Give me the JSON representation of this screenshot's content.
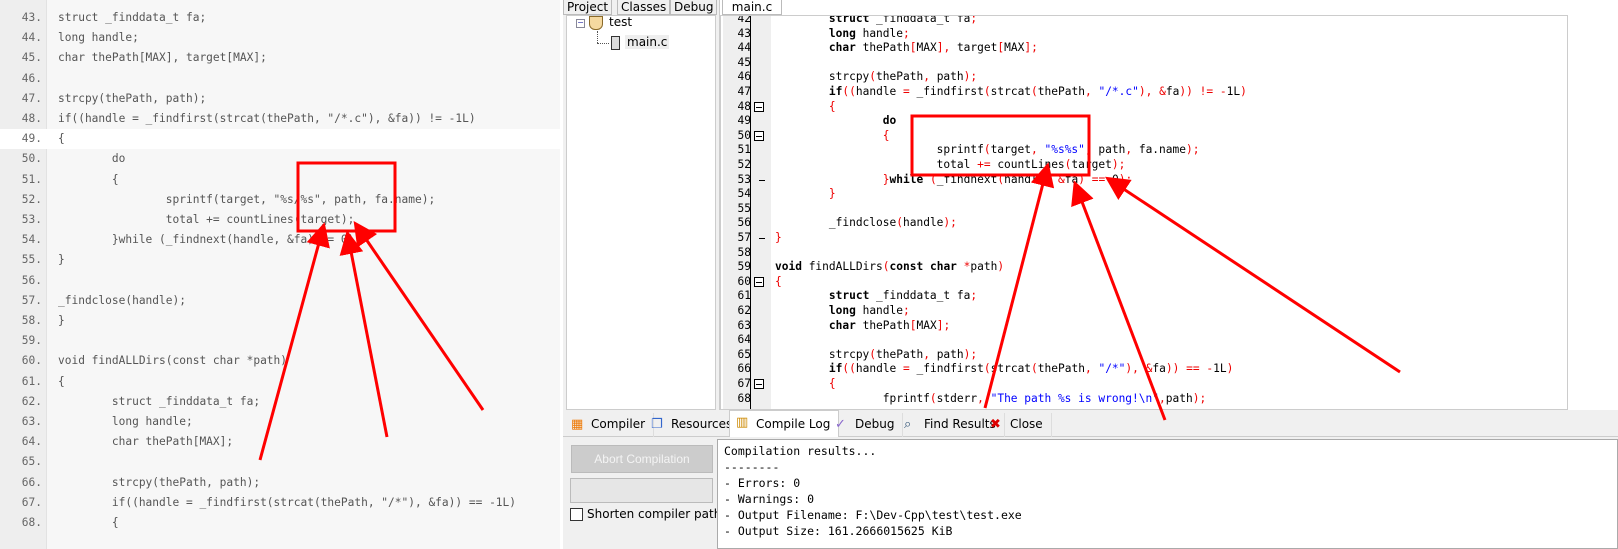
{
  "left_code": {
    "start": 43,
    "highlight_line": 49,
    "lines": [
      "struct _finddata_t fa;",
      "long handle;",
      "char thePath[MAX], target[MAX];",
      "",
      "strcpy(thePath, path);",
      "if((handle = _findfirst(strcat(thePath, \"/*.c\"), &fa)) != -1L)",
      "{",
      "        do",
      "        {",
      "                sprintf(target, \"%s/%s\", path, fa.name);",
      "                total += countLines(target);",
      "        }while (_findnext(handle, &fa) == 0);",
      "}",
      "",
      "_findclose(handle);",
      "}",
      "",
      "void findALLDirs(const char *path)",
      "{",
      "        struct _finddata_t fa;",
      "        long handle;",
      "        char thePath[MAX];",
      "",
      "        strcpy(thePath, path);",
      "        if((handle = _findfirst(strcat(thePath, \"/*\"), &fa)) == -1L)",
      "        {"
    ]
  },
  "project": {
    "tabs": [
      "Project",
      "Classes",
      "Debug"
    ],
    "root": "test",
    "file": "main.c"
  },
  "editor": {
    "tab": "main.c",
    "start": 42,
    "lines": [
      "        struct _finddata_t fa;",
      "        long handle;",
      "        char thePath[MAX], target[MAX];",
      "",
      "        strcpy(thePath, path);",
      "        if((handle = _findfirst(strcat(thePath, \"/*.c\"), &fa)) != -1L)",
      "        {",
      "                do",
      "                {",
      "                        sprintf(target, \"%s%s\", path, fa.name);",
      "                        total += countLines(target);",
      "                }while (_findnext(handle, &fa) == 0);",
      "        }",
      "",
      "        _findclose(handle);",
      "}",
      "",
      "void findALLDirs(const char *path)",
      "{",
      "        struct _finddata_t fa;",
      "        long handle;",
      "        char thePath[MAX];",
      "",
      "        strcpy(thePath, path);",
      "        if((handle = _findfirst(strcat(thePath, \"/*\"), &fa)) == -1L)",
      "        {",
      "                fprintf(stderr, \"The path %s is wrong!\\n\",path);"
    ],
    "folds": [
      48,
      50,
      60,
      67
    ],
    "ends": [
      53,
      57
    ]
  },
  "bottom_tabs": [
    {
      "label": "Compiler",
      "icon": "grid-icon"
    },
    {
      "label": "Resources",
      "icon": "resources-icon"
    },
    {
      "label": "Compile Log",
      "icon": "bar-chart-icon",
      "active": true
    },
    {
      "label": "Debug",
      "icon": "check-icon"
    },
    {
      "label": "Find Results",
      "icon": "magnifier-icon"
    },
    {
      "label": "Close",
      "icon": "close-icon"
    }
  ],
  "compile": {
    "abort_label": "Abort Compilation",
    "shorten_label": "Shorten compiler paths",
    "shorten_checked": false,
    "log": [
      "Compilation results...",
      "--------",
      "- Errors: 0",
      "- Warnings: 0",
      "- Output Filename: F:\\Dev-Cpp\\test\\test.exe",
      "- Output Size: 161.2666015625 KiB"
    ]
  },
  "colors": {
    "annotation": "#ff0000",
    "keyword": "#000000",
    "punct": "#ee0000",
    "string": "#0000ff"
  }
}
